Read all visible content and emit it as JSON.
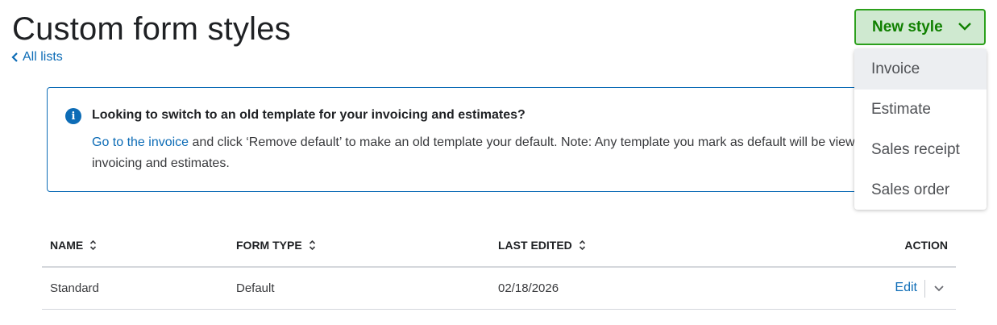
{
  "header": {
    "title": "Custom form styles",
    "back_link": "All lists",
    "new_style_button": "New style"
  },
  "new_style_menu": {
    "items": [
      "Invoice",
      "Estimate",
      "Sales receipt",
      "Sales order"
    ]
  },
  "banner": {
    "heading": "Looking to switch to an old template for your invoicing and estimates?",
    "link_text": "Go to the invoice",
    "body_text": " and click ‘Remove default’ to make an old template your default. Note: Any template you mark as default will be view only for invoicing and estimates."
  },
  "table": {
    "columns": {
      "name": "NAME",
      "form_type": "FORM TYPE",
      "last_edited": "LAST EDITED",
      "action": "ACTION"
    },
    "rows": [
      {
        "name": "Standard",
        "form_type": "Default",
        "last_edited": "02/18/2026",
        "action": "Edit"
      }
    ]
  },
  "colors": {
    "accent_link": "#0d6cb6",
    "button_border": "#2ca01c",
    "button_bg": "#cfe9d0",
    "button_text": "#108000"
  }
}
